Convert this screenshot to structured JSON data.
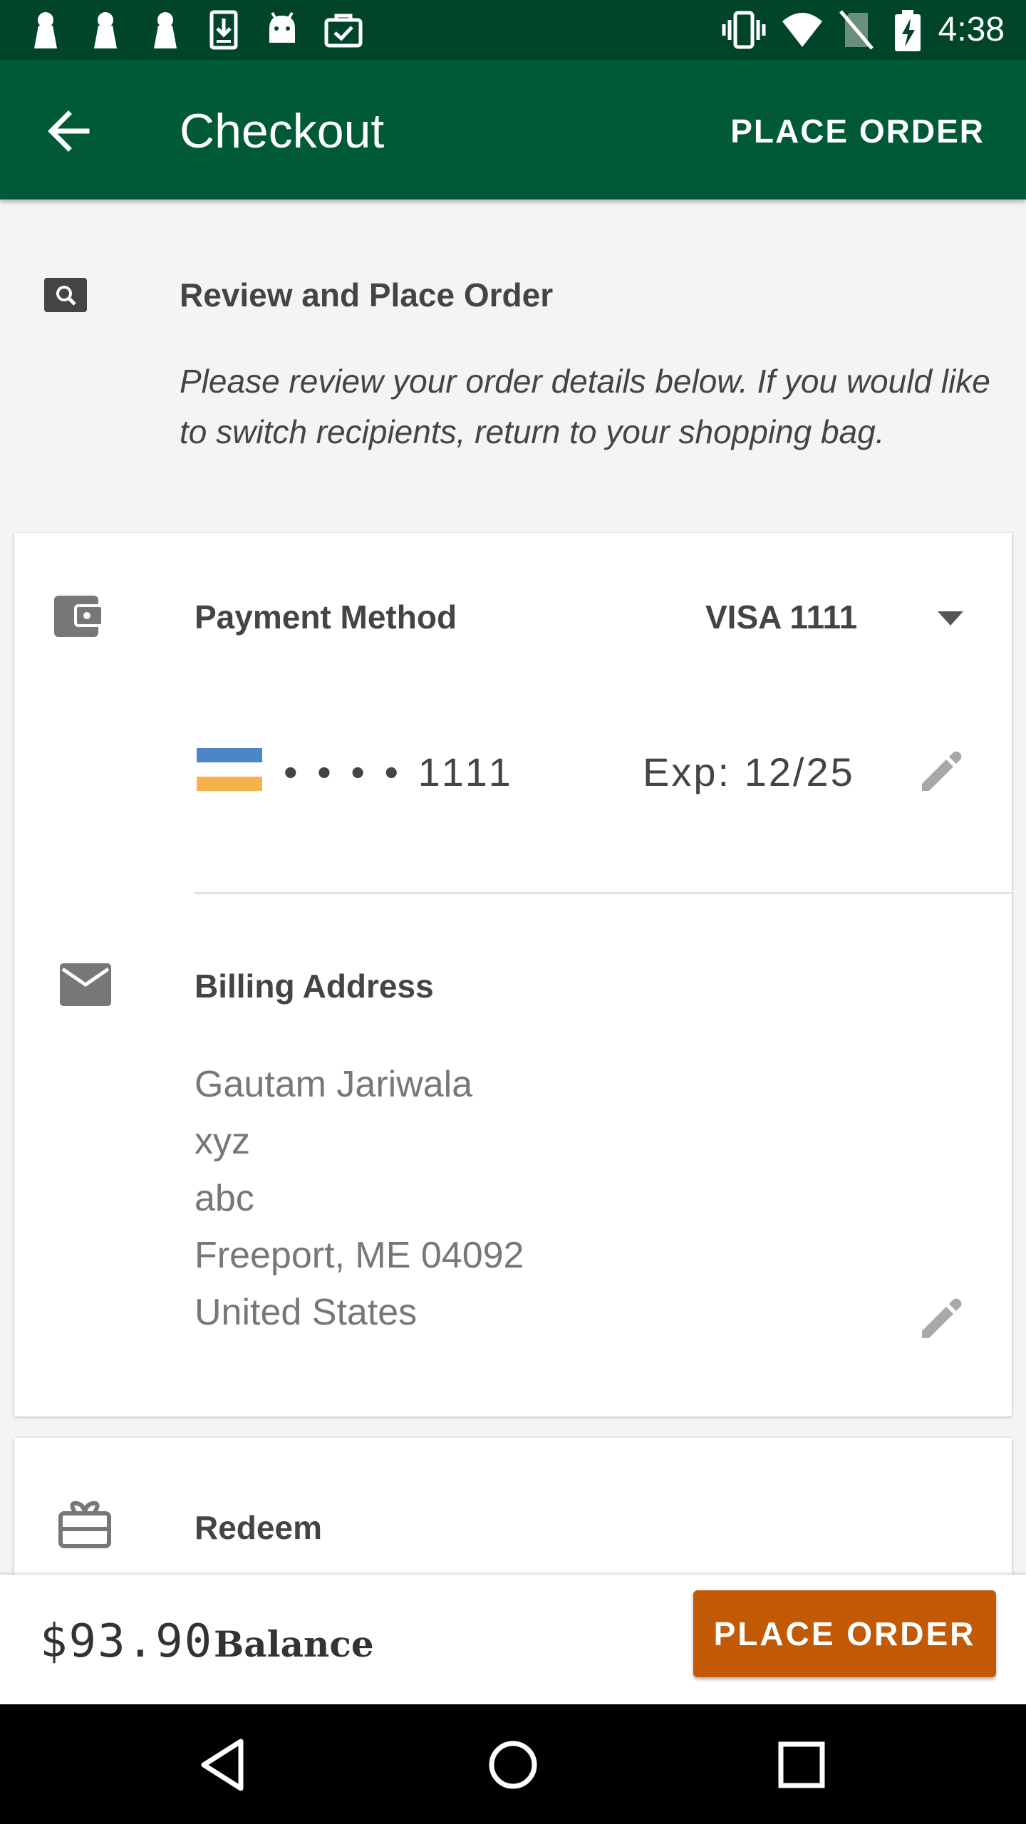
{
  "status_bar": {
    "time": "4:38",
    "icons": [
      "keyhole-icon",
      "keyhole-icon",
      "keyhole-icon",
      "download-icon",
      "android-icon",
      "briefcase-check-icon",
      "vibrate-icon",
      "wifi-icon",
      "no-sim-icon",
      "battery-charging-icon"
    ]
  },
  "toolbar": {
    "title": "Checkout",
    "action_label": "PLACE ORDER",
    "back_icon": "arrow-back-icon"
  },
  "review": {
    "heading": "Review and Place Order",
    "description": "Please review your order details below. If you would like to switch recipients, return to your shopping bag."
  },
  "payment": {
    "label": "Payment Method",
    "selected": "VISA 1111",
    "card_number": "• • • • 1111",
    "expiry": "Exp: 12/25",
    "card_colors": [
      "#4a86c8",
      "#f7b34b"
    ]
  },
  "billing": {
    "label": "Billing Address",
    "address_lines": [
      "Gautam Jariwala",
      "xyz",
      "abc",
      "Freeport, ME 04092",
      "United States"
    ]
  },
  "redeem": {
    "label": "Redeem"
  },
  "bottom_bar": {
    "balance_amount": "$93.90",
    "balance_label": "Balance",
    "button_label": "PLACE ORDER",
    "button_color": "#c25a05"
  },
  "theme": {
    "primary": "#005a38",
    "status_bar": "#00452a"
  }
}
